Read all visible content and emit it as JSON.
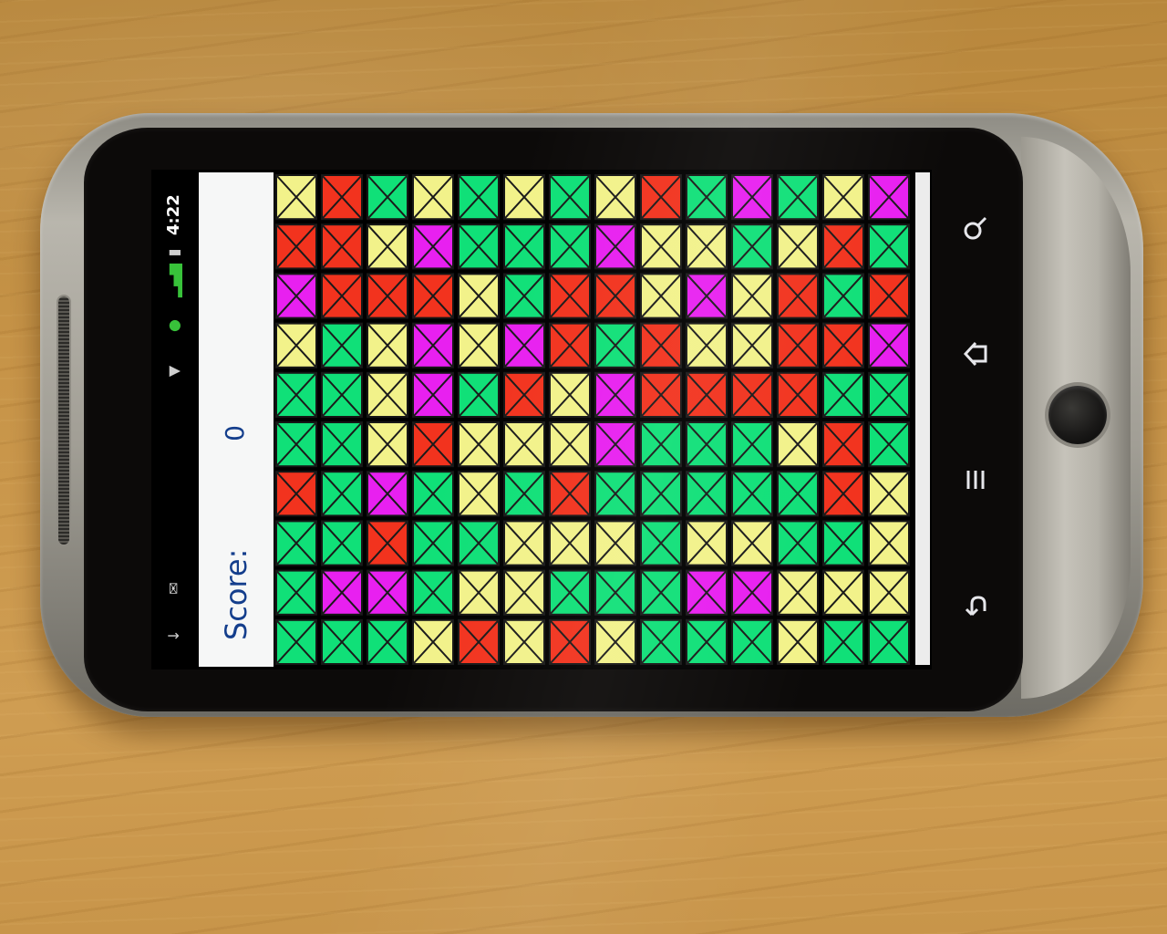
{
  "status_bar": {
    "time": "4:22",
    "icons": [
      "battery-icon",
      "signal-icon",
      "wifi-icon",
      "mute-icon",
      "message-icon",
      "download-icon"
    ]
  },
  "score": {
    "label": "Score:",
    "value": "0"
  },
  "nav_keys": {
    "search": "search-icon",
    "home": "home-icon",
    "menu": "menu-icon",
    "back": "back-icon"
  },
  "palette": {
    "Y": "#f2f28a",
    "R": "#f2331e",
    "G": "#10e078",
    "M": "#e820f0"
  },
  "board": {
    "rows": [
      [
        "Y",
        "R",
        "G",
        "Y",
        "G",
        "Y",
        "G",
        "Y",
        "R",
        "G",
        "M",
        "G",
        "Y",
        "M"
      ],
      [
        "R",
        "R",
        "Y",
        "M",
        "G",
        "G",
        "G",
        "M",
        "Y",
        "Y",
        "G",
        "Y",
        "R",
        "G"
      ],
      [
        "M",
        "R",
        "R",
        "R",
        "Y",
        "G",
        "R",
        "R",
        "Y",
        "M",
        "Y",
        "R",
        "G",
        "R"
      ],
      [
        "Y",
        "G",
        "Y",
        "M",
        "Y",
        "M",
        "R",
        "G",
        "R",
        "Y",
        "Y",
        "R",
        "R",
        "M"
      ],
      [
        "G",
        "G",
        "Y",
        "M",
        "G",
        "R",
        "Y",
        "M",
        "R",
        "R",
        "R",
        "R",
        "G",
        "G"
      ],
      [
        "G",
        "G",
        "Y",
        "R",
        "Y",
        "Y",
        "Y",
        "M",
        "G",
        "G",
        "G",
        "Y",
        "R",
        "G"
      ],
      [
        "R",
        "G",
        "M",
        "G",
        "Y",
        "G",
        "R",
        "G",
        "G",
        "G",
        "G",
        "G",
        "R",
        "Y"
      ],
      [
        "G",
        "G",
        "R",
        "G",
        "G",
        "Y",
        "Y",
        "Y",
        "G",
        "Y",
        "Y",
        "G",
        "G",
        "Y"
      ],
      [
        "G",
        "M",
        "M",
        "G",
        "Y",
        "Y",
        "G",
        "G",
        "G",
        "M",
        "M",
        "Y",
        "Y",
        "Y"
      ],
      [
        "G",
        "G",
        "G",
        "Y",
        "R",
        "Y",
        "R",
        "Y",
        "G",
        "G",
        "G",
        "Y",
        "G",
        "G"
      ]
    ]
  }
}
